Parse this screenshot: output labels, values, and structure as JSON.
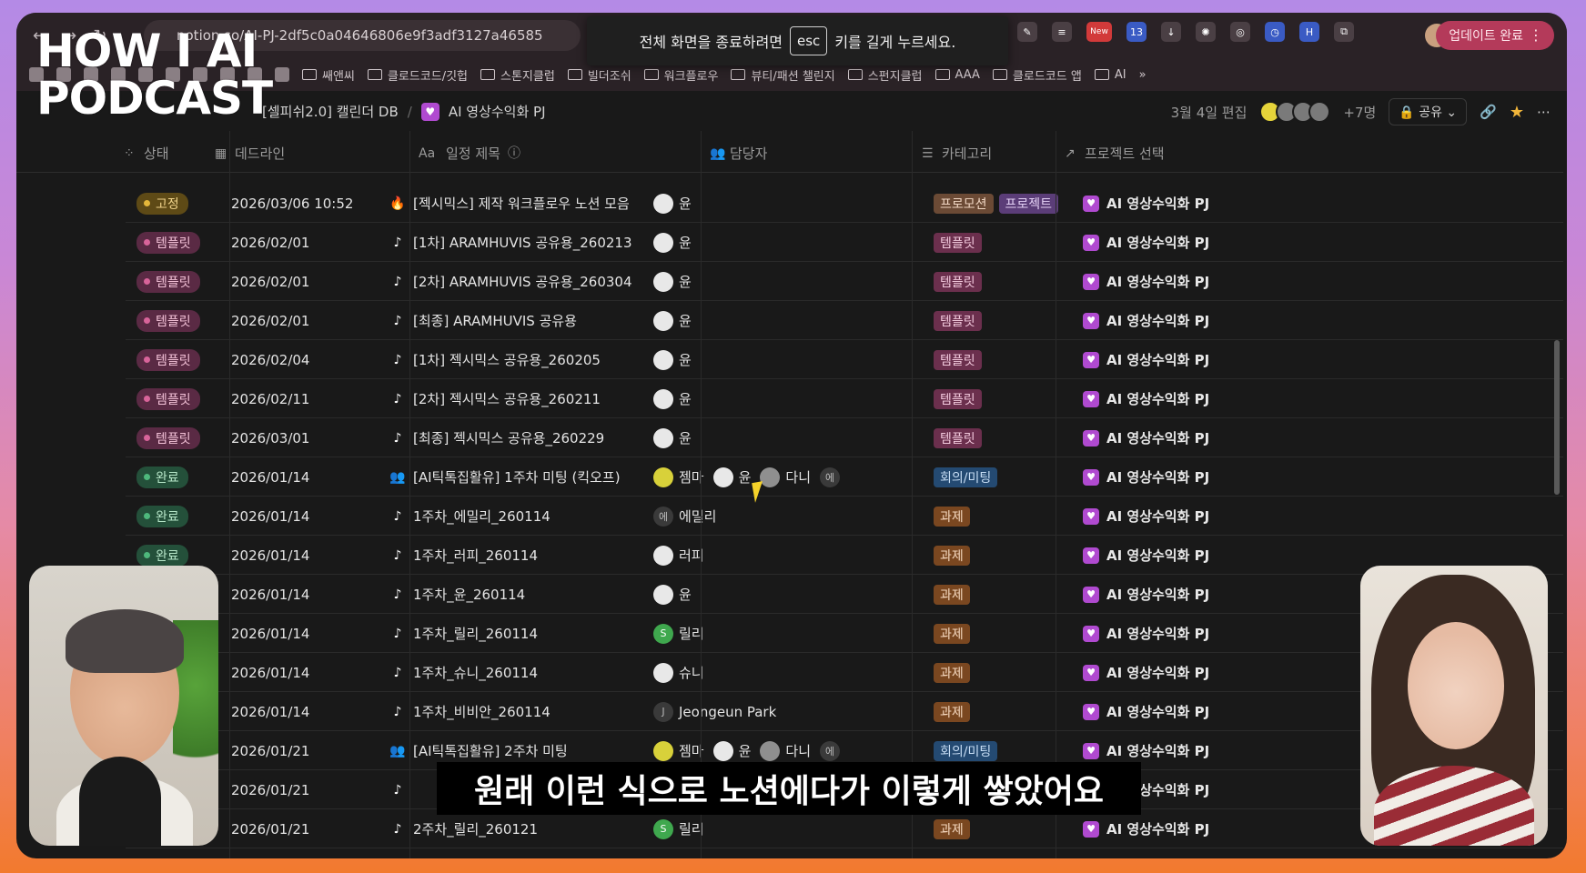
{
  "browser": {
    "url": "notion.so/AI-PJ-2df5c0a04646806e9f3adf3127a46585",
    "fullscreen_notice_before": "전체 화면을 종료하려면",
    "fullscreen_notice_key": "esc",
    "fullscreen_notice_after": "키를 길게 누르세요.",
    "update_button": "업데이트 완료",
    "new_badge": "New",
    "ext_count": "13",
    "bookmarks": [
      "쌔앤씨",
      "클로드코드/깃헙",
      "스톤지클럽",
      "빌더조쉬",
      "워크플로우",
      "뷰티/패션 챌린지",
      "스펀지클럽",
      "AAA",
      "클로드코드 앱",
      "AI"
    ]
  },
  "brand": {
    "line1": "HOW I AI",
    "line2": "PODCAST"
  },
  "notion": {
    "breadcrumb_db": "[셀피쉬2.0] 캘린더 DB",
    "breadcrumb_separator": "/",
    "breadcrumb_page": "AI 영상수익화 PJ",
    "edited": "3월 4일 편집",
    "member_count": "+7명",
    "share_label": "공유"
  },
  "table": {
    "columns": {
      "status": "상태",
      "deadline": "데드라인",
      "title": "일정 제목",
      "assignee": "담당자",
      "category": "카테고리",
      "project": "프로젝트 선택"
    },
    "rows": [
      {
        "status": "고정",
        "stype": "fixed",
        "date": "2026/03/06 10:52",
        "icon": "fire",
        "title": "[젝시믹스] 제작 워크플로우 노션 모음",
        "people": [
          {
            "n": "윤",
            "a": "white"
          }
        ],
        "tags": [
          {
            "t": "프로모션",
            "c": "promo"
          },
          {
            "t": "프로젝트",
            "c": "proj"
          }
        ],
        "project": "AI 영상수익화 PJ"
      },
      {
        "status": "템플릿",
        "stype": "tmpl",
        "date": "2026/02/01",
        "icon": "tiktok",
        "title": "[1차] ARAMHUVIS 공유용_260213",
        "people": [
          {
            "n": "윤",
            "a": "white"
          }
        ],
        "tags": [
          {
            "t": "템플릿",
            "c": "tmpl"
          }
        ],
        "project": "AI 영상수익화 PJ"
      },
      {
        "status": "템플릿",
        "stype": "tmpl",
        "date": "2026/02/01",
        "icon": "tiktok",
        "title": "[2차] ARAMHUVIS 공유용_260304",
        "people": [
          {
            "n": "윤",
            "a": "white"
          }
        ],
        "tags": [
          {
            "t": "템플릿",
            "c": "tmpl"
          }
        ],
        "project": "AI 영상수익화 PJ"
      },
      {
        "status": "템플릿",
        "stype": "tmpl",
        "date": "2026/02/01",
        "icon": "tiktok",
        "title": "[최종] ARAMHUVIS 공유용",
        "people": [
          {
            "n": "윤",
            "a": "white"
          }
        ],
        "tags": [
          {
            "t": "템플릿",
            "c": "tmpl"
          }
        ],
        "project": "AI 영상수익화 PJ"
      },
      {
        "status": "템플릿",
        "stype": "tmpl",
        "date": "2026/02/04",
        "icon": "tiktok",
        "title": "[1차] 젝시믹스 공유용_260205",
        "people": [
          {
            "n": "윤",
            "a": "white"
          }
        ],
        "tags": [
          {
            "t": "템플릿",
            "c": "tmpl"
          }
        ],
        "project": "AI 영상수익화 PJ"
      },
      {
        "status": "템플릿",
        "stype": "tmpl",
        "date": "2026/02/11",
        "icon": "tiktok",
        "title": "[2차] 젝시믹스 공유용_260211",
        "people": [
          {
            "n": "윤",
            "a": "white"
          }
        ],
        "tags": [
          {
            "t": "템플릿",
            "c": "tmpl"
          }
        ],
        "project": "AI 영상수익화 PJ"
      },
      {
        "status": "템플릿",
        "stype": "tmpl",
        "date": "2026/03/01",
        "icon": "tiktok",
        "title": "[최종] 젝시믹스 공유용_260229",
        "people": [
          {
            "n": "윤",
            "a": "white"
          }
        ],
        "tags": [
          {
            "t": "템플릿",
            "c": "tmpl"
          }
        ],
        "project": "AI 영상수익화 PJ"
      },
      {
        "status": "완료",
        "stype": "done",
        "date": "2026/01/14",
        "icon": "people",
        "title": "[AI틱톡집활유] 1주차 미팅 (킥오프)",
        "people": [
          {
            "n": "젬마",
            "a": "yellow"
          },
          {
            "n": "윤",
            "a": "white"
          },
          {
            "n": "다니",
            "a": "gray"
          },
          {
            "n": "",
            "a": "dark",
            "i": "에"
          }
        ],
        "tags": [
          {
            "t": "회의/미팅",
            "c": "meet"
          }
        ],
        "project": "AI 영상수익화 PJ"
      },
      {
        "status": "완료",
        "stype": "done",
        "date": "2026/01/14",
        "icon": "tiktok",
        "title": "1주차_에밀리_260114",
        "people": [
          {
            "n": "에밀리",
            "a": "dark",
            "i": "에"
          }
        ],
        "tags": [
          {
            "t": "과제",
            "c": "task"
          }
        ],
        "project": "AI 영상수익화 PJ"
      },
      {
        "status": "완료",
        "stype": "done",
        "date": "2026/01/14",
        "icon": "tiktok",
        "title": "1주차_러피_260114",
        "people": [
          {
            "n": "러피",
            "a": "white"
          }
        ],
        "tags": [
          {
            "t": "과제",
            "c": "task"
          }
        ],
        "project": "AI 영상수익화 PJ"
      },
      {
        "status": "완료",
        "stype": "done",
        "date": "2026/01/14",
        "icon": "tiktok",
        "title": "1주차_윤_260114",
        "people": [
          {
            "n": "윤",
            "a": "white"
          }
        ],
        "tags": [
          {
            "t": "과제",
            "c": "task"
          }
        ],
        "project": "AI 영상수익화 PJ"
      },
      {
        "status": "완료",
        "stype": "done",
        "date": "2026/01/14",
        "icon": "tiktok",
        "title": "1주차_릴리_260114",
        "people": [
          {
            "n": "릴리",
            "a": "green",
            "i": "S"
          }
        ],
        "tags": [
          {
            "t": "과제",
            "c": "task"
          }
        ],
        "project": "AI 영상수익화 PJ"
      },
      {
        "status": "완료",
        "stype": "done",
        "date": "2026/01/14",
        "icon": "tiktok",
        "title": "1주차_슈니_260114",
        "people": [
          {
            "n": "슈니",
            "a": "white"
          }
        ],
        "tags": [
          {
            "t": "과제",
            "c": "task"
          }
        ],
        "project": "AI 영상수익화 PJ"
      },
      {
        "status": "완료",
        "stype": "done",
        "date": "2026/01/14",
        "icon": "tiktok",
        "title": "1주차_비비안_260114",
        "people": [
          {
            "n": "Jeongeun Park",
            "a": "dark",
            "i": "J"
          }
        ],
        "tags": [
          {
            "t": "과제",
            "c": "task"
          }
        ],
        "project": "AI 영상수익화 PJ"
      },
      {
        "status": "완료",
        "stype": "done",
        "date": "2026/01/21",
        "icon": "people",
        "title": "[AI틱톡집활유] 2주차 미팅",
        "people": [
          {
            "n": "젬마",
            "a": "yellow"
          },
          {
            "n": "윤",
            "a": "white"
          },
          {
            "n": "다니",
            "a": "gray"
          },
          {
            "n": "",
            "a": "dark",
            "i": "에"
          }
        ],
        "tags": [
          {
            "t": "회의/미팅",
            "c": "meet"
          }
        ],
        "project": "AI 영상수익화 PJ"
      },
      {
        "status": "완료",
        "stype": "done",
        "date": "2026/01/21",
        "icon": "tiktok",
        "title": "",
        "people": [],
        "tags": [],
        "project": "AI 영상수익화 PJ"
      },
      {
        "status": "완료",
        "stype": "done",
        "date": "2026/01/21",
        "icon": "tiktok",
        "title": "2주차_릴리_260121",
        "people": [
          {
            "n": "릴리",
            "a": "green",
            "i": "S"
          }
        ],
        "tags": [
          {
            "t": "과제",
            "c": "task"
          }
        ],
        "project": "AI 영상수익화 PJ"
      }
    ]
  },
  "subtitle": "원래 이런 식으로 노션에다가 이렇게 쌓았어요",
  "colors": {
    "accent_purple": "#b04ad0",
    "status_done": "#24503a",
    "status_template": "#5a2a44",
    "status_fixed": "#5e4a16"
  }
}
